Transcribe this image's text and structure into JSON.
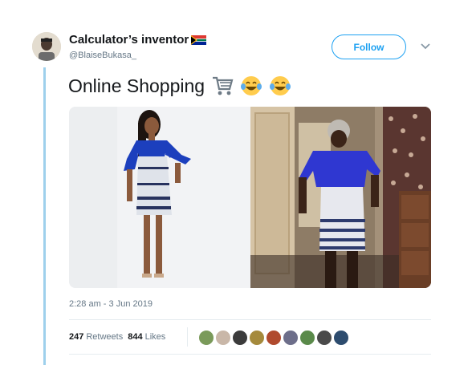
{
  "tweet": {
    "display_name": "Calculator’s inventor",
    "handle": "@BlaiseBukasa_",
    "text": "Online Shopping",
    "emojis": [
      "shopping-cart",
      "face-with-tears-of-joy",
      "face-with-tears-of-joy"
    ],
    "timestamp": "2:28 am - 3 Jun 2019",
    "follow_label": "Follow",
    "retweets": {
      "count": "247",
      "label": "Retweets"
    },
    "likes": {
      "count": "844",
      "label": "Likes"
    }
  },
  "media": {
    "left_image": "studio photo of model wearing blue bell-sleeve top with patterned pencil skirt",
    "right_image": "home photo of woman wearing similar blue bell-sleeve top with patterned skirt"
  },
  "colors": {
    "accent": "#1da1f2",
    "thread_line": "#9ed0ec",
    "secondary_text": "#657786"
  },
  "likers": [
    {
      "color": "#7a9a5a"
    },
    {
      "color": "#c9b7a8"
    },
    {
      "color": "#3b3b3b"
    },
    {
      "color": "#a58a3c"
    },
    {
      "color": "#b04a2e"
    },
    {
      "color": "#6d6e8a"
    },
    {
      "color": "#5a8a4a"
    },
    {
      "color": "#4a4a4a"
    },
    {
      "color": "#2d4c6e"
    }
  ]
}
